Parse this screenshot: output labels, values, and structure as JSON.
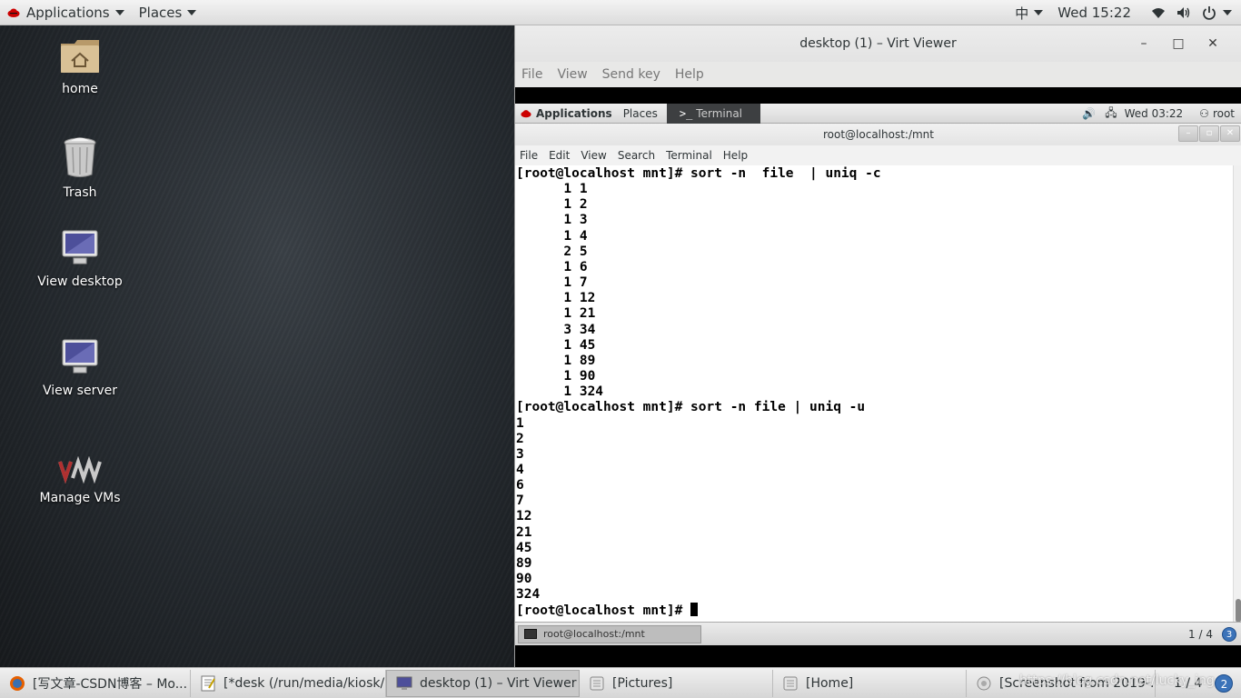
{
  "topbar": {
    "applications": "Applications",
    "places": "Places",
    "input_method": "中",
    "clock": "Wed 15:22"
  },
  "desktop": {
    "icons": [
      {
        "label": "home"
      },
      {
        "label": "Trash"
      },
      {
        "label": "View desktop"
      },
      {
        "label": "View server"
      },
      {
        "label": "Manage VMs"
      }
    ]
  },
  "viewer": {
    "title": "desktop (1) – Virt Viewer",
    "menu": [
      "File",
      "View",
      "Send key",
      "Help"
    ]
  },
  "guest": {
    "topbar": {
      "applications": "Applications",
      "places": "Places",
      "terminal_tab": "Terminal",
      "clock": "Wed 03:22",
      "user": "root"
    },
    "terminal_title": "root@localhost:/mnt",
    "terminal_menu": [
      "File",
      "Edit",
      "View",
      "Search",
      "Terminal",
      "Help"
    ],
    "terminal_lines": [
      "[root@localhost mnt]# sort -n  file  | uniq -c",
      "      1 1",
      "      1 2",
      "      1 3",
      "      1 4",
      "      2 5",
      "      1 6",
      "      1 7",
      "      1 12",
      "      1 21",
      "      3 34",
      "      1 45",
      "      1 89",
      "      1 90",
      "      1 324",
      "[root@localhost mnt]# sort -n file | uniq -u",
      "1",
      "2",
      "3",
      "4",
      "6",
      "7",
      "12",
      "21",
      "45",
      "89",
      "90",
      "324"
    ],
    "prompt": "[root@localhost mnt]# ",
    "taskbar_item": "root@localhost:/mnt",
    "pager": "1 / 4",
    "badge": "3"
  },
  "taskbar": {
    "tasks": [
      "[写文章-CSDN博客 – Mo...",
      "[*desk (/run/media/kiosk/...",
      "desktop (1) – Virt Viewer",
      "[Pictures]",
      "[Home]",
      "[Screenshot from 2019-..."
    ],
    "pager": "1 / 4",
    "badge": "2",
    "watermark": "https://blog.csdn.net/lucky_ing"
  },
  "colors": {
    "terminal_bg": "#ffffff",
    "terminal_fg": "#000000",
    "pager_badge": "#3b73b9"
  }
}
